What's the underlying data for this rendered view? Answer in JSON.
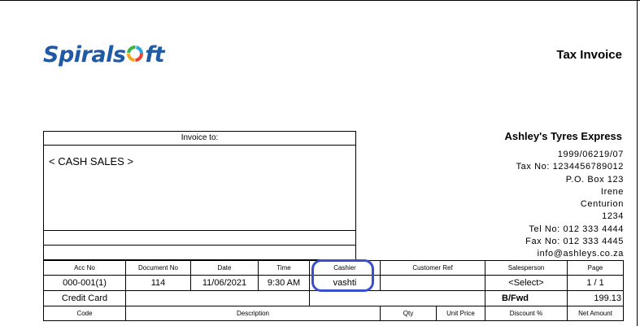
{
  "logo": {
    "text_before": "Spirals",
    "text_after": "ft"
  },
  "document": {
    "title": "Tax Invoice"
  },
  "company": {
    "name": "Ashley's Tyres Express",
    "lines": [
      "1999/06219/07",
      "Tax No:  1234456789012",
      "P.O. Box 123",
      "Irene",
      "Centurion",
      "1234",
      "Tel No:  012 333 4444",
      "Fax No:  012 333 4445",
      "info@ashleys.co.za"
    ]
  },
  "invoice_to": {
    "header": "Invoice to:",
    "customer": "< CASH SALES >"
  },
  "grid": {
    "headers": [
      "Acc No",
      "Document No",
      "Date",
      "Time",
      "Cashier",
      "Customer Ref",
      "Salesperson",
      "Page"
    ],
    "values": [
      "000-001(1)",
      "114",
      "11/06/2021",
      "9:30 AM",
      "vashti",
      "",
      "<Select>",
      "1  /  1"
    ],
    "payment_method": "Credit Card",
    "bfwd_label": "B/Fwd",
    "bfwd_value": "199.13",
    "columns": [
      "Code",
      "Description",
      "Qty",
      "Unit Price",
      "Discount %",
      "Net Amount"
    ]
  },
  "colors": {
    "logo": "#1f5aa6",
    "highlight": "#3b4fcc"
  }
}
